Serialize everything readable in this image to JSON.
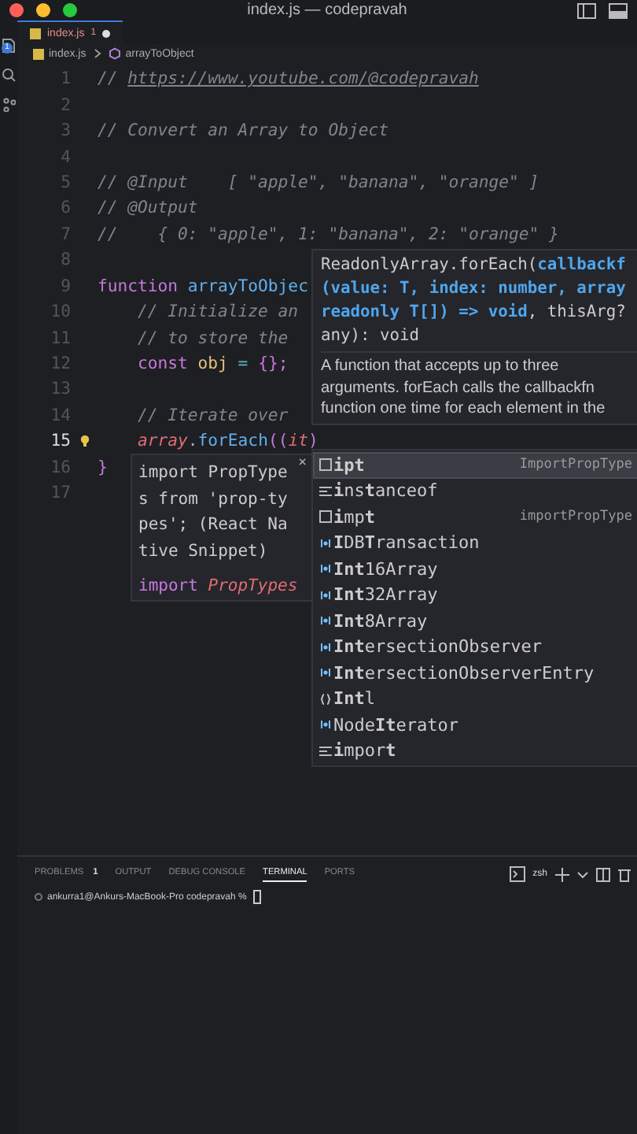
{
  "window": {
    "title": "index.js — codepravah"
  },
  "activity_bar": {
    "badge": "1"
  },
  "tabs": [
    {
      "label": "index.js",
      "problems": "1",
      "dirty": true,
      "selected": true
    }
  ],
  "breadcrumb": [
    "index.js",
    "arrayToObject"
  ],
  "editor": {
    "lines": [
      {
        "number": "1",
        "current": false,
        "tokens": [
          {
            "t": "// ",
            "kind": "comment"
          },
          {
            "t": "https://www.youtube.com/@codepravah",
            "kind": "link"
          }
        ]
      },
      {
        "number": "2",
        "current": false
      },
      {
        "number": "3",
        "current": false,
        "tokens": [
          {
            "t": "// Convert an Array to Object",
            "kind": "comment"
          }
        ]
      },
      {
        "number": "4",
        "current": false
      },
      {
        "number": "5",
        "current": false,
        "tokens": [
          {
            "t": "// @Input    [ \"apple\", \"banana\", \"orange\" ]",
            "kind": "comment"
          }
        ]
      },
      {
        "number": "6",
        "current": false,
        "tokens": [
          {
            "t": "// @Output",
            "kind": "comment"
          }
        ]
      },
      {
        "number": "7",
        "current": false,
        "tokens": [
          {
            "t": "//    { 0: \"apple\", 1: \"banana\", 2: \"orange\" }",
            "kind": "comment"
          }
        ]
      },
      {
        "number": "8",
        "current": false
      },
      {
        "number": "9",
        "current": false,
        "tokens": [
          {
            "t": "function ",
            "kind": "keyword"
          },
          {
            "t": "arrayToObjec",
            "kind": "fn"
          }
        ]
      },
      {
        "number": "10",
        "current": false,
        "tokens": [
          {
            "t": "    // Initialize an",
            "kind": "comment"
          }
        ]
      },
      {
        "number": "11",
        "current": false,
        "tokens": [
          {
            "t": "    // to store the",
            "kind": "comment"
          }
        ]
      },
      {
        "number": "12",
        "current": false,
        "tokens": [
          {
            "t": "    const ",
            "kind": "keyword"
          },
          {
            "t": "obj",
            "kind": "const"
          },
          {
            "t": " = ",
            "kind": "op"
          },
          {
            "t": "{};",
            "kind": "punct"
          }
        ]
      },
      {
        "number": "13",
        "current": false
      },
      {
        "number": "14",
        "current": false,
        "tokens": [
          {
            "t": "    // Iterate over",
            "kind": "comment"
          }
        ]
      },
      {
        "number": "15",
        "current": true,
        "tokens": [
          {
            "t": "    array",
            "kind": "var"
          },
          {
            "t": ".",
            "kind": "plain"
          },
          {
            "t": "forEach",
            "kind": "fn"
          },
          {
            "t": "((",
            "kind": "punct"
          },
          {
            "t": "it",
            "kind": "var"
          },
          {
            "t": ")",
            "kind": "punct"
          }
        ]
      },
      {
        "number": "16",
        "current": false,
        "tokens": [
          {
            "t": "}",
            "kind": "punct"
          }
        ]
      },
      {
        "number": "17",
        "current": false
      }
    ]
  },
  "hover": {
    "signature": [
      [
        {
          "t": "ReadonlyArray.forEach(",
          "param": false
        },
        {
          "t": "callbackf",
          "param": true
        }
      ],
      [
        {
          "t": "(value: T, index: number, array",
          "param": true
        }
      ],
      [
        {
          "t": "readonly T[]) => void",
          "param": true
        },
        {
          "t": ", thisArg?",
          "param": false
        }
      ],
      [
        {
          "t": "any): void",
          "param": false
        }
      ]
    ],
    "doc": "A function that accepts up to three arguments. forEach calls the callbackfn function one time for each element in the"
  },
  "snippet_detail": {
    "text": "import PropTypes from 'prop-types'; (React Native Snippet)",
    "close": "×",
    "code": [
      {
        "t": "import ",
        "kind": "keyword"
      },
      {
        "t": "PropTypes",
        "kind": "var"
      }
    ]
  },
  "suggestions": [
    {
      "label": "**ipt**",
      "kind": "snippet",
      "detail": "ImportPropType",
      "selected": true
    },
    {
      "label": "**i**ns**t**anceof",
      "kind": "keyword",
      "selected": false
    },
    {
      "label": "**i**mp**t**",
      "kind": "snippet",
      "detail": "importPropType",
      "selected": false
    },
    {
      "label": "**I**DB**T**ransaction",
      "kind": "variable",
      "selected": false
    },
    {
      "label": "**Int**16Array",
      "kind": "variable",
      "selected": false
    },
    {
      "label": "**Int**32Array",
      "kind": "variable",
      "selected": false
    },
    {
      "label": "**Int**8Array",
      "kind": "variable",
      "selected": false
    },
    {
      "label": "**Int**ersectionObserver",
      "kind": "variable",
      "selected": false
    },
    {
      "label": "**Int**ersectionObserverEntry",
      "kind": "variable",
      "selected": false
    },
    {
      "label": "**Int**l",
      "kind": "module",
      "selected": false
    },
    {
      "label": "Node**It**erator",
      "kind": "variable",
      "selected": false
    },
    {
      "label": "**i**mpor**t**",
      "kind": "keyword",
      "selected": false
    }
  ],
  "panel": {
    "tabs": [
      {
        "label": "PROBLEMS",
        "count": "1",
        "selected": false
      },
      {
        "label": "OUTPUT",
        "selected": false
      },
      {
        "label": "DEBUG CONSOLE",
        "selected": false
      },
      {
        "label": "TERMINAL",
        "selected": true
      },
      {
        "label": "PORTS",
        "selected": false
      }
    ],
    "shell": "zsh",
    "prompt": "ankurra1@Ankurs-MacBook-Pro codepravah % "
  }
}
